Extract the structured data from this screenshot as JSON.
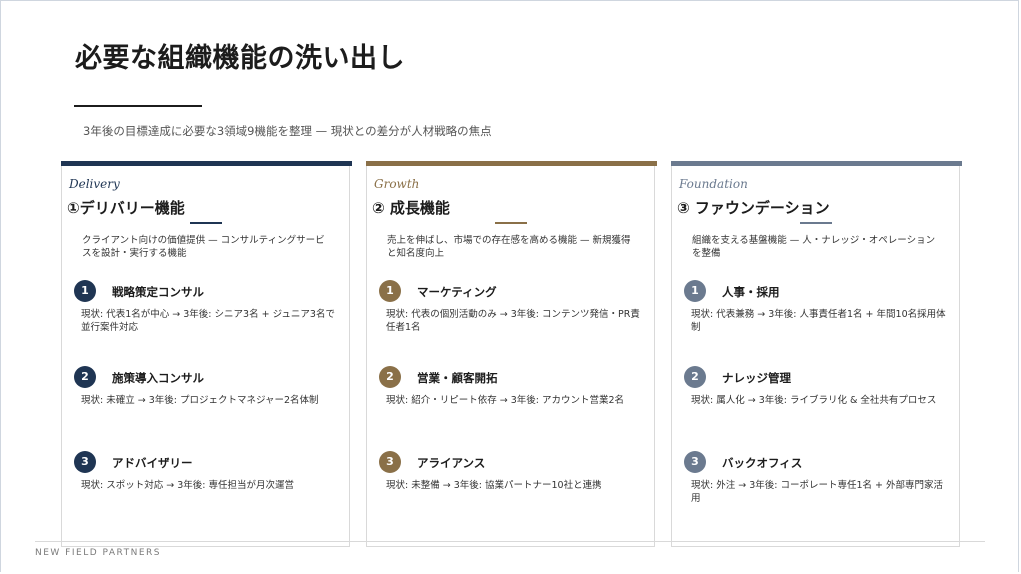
{
  "title": "必要な組織機能の洗い出し",
  "subtitle": "3年後の目標達成に必要な3領域9機能を整理 — 現状との差分が人材戦略の焦点",
  "footer": "NEW FIELD PARTNERS",
  "colors": {
    "delivery": "#1f3553",
    "growth": "#8a7048",
    "foundation": "#6b7a8f"
  },
  "cards": [
    {
      "category": "Delivery",
      "title": "①デリバリー機能",
      "description": "クライアント向けの価値提供 — コンサルティングサービスを設計・実行する機能",
      "items": [
        {
          "num": "1",
          "title": "戦略策定コンサル",
          "desc": "現状: 代表1名が中心 → 3年後: シニア3名 + ジュニア3名で並行案件対応"
        },
        {
          "num": "2",
          "title": "施策導入コンサル",
          "desc": "現状: 未確立 → 3年後: プロジェクトマネジャー2名体制"
        },
        {
          "num": "3",
          "title": "アドバイザリー",
          "desc": "現状: スポット対応 → 3年後: 専任担当が月次運営"
        }
      ]
    },
    {
      "category": "Growth",
      "title": "② 成長機能",
      "description": "売上を伸ばし、市場での存在感を高める機能 — 新規獲得と知名度向上",
      "items": [
        {
          "num": "1",
          "title": "マーケティング",
          "desc": "現状: 代表の個別活動のみ → 3年後: コンテンツ発信・PR責任者1名"
        },
        {
          "num": "2",
          "title": "営業・顧客開拓",
          "desc": "現状: 紹介・リピート依存 → 3年後: アカウント営業2名"
        },
        {
          "num": "3",
          "title": "アライアンス",
          "desc": "現状: 未整備 → 3年後: 協業パートナー10社と連携"
        }
      ]
    },
    {
      "category": "Foundation",
      "title": "③ ファウンデーション",
      "description": "組織を支える基盤機能 — 人・ナレッジ・オペレーションを整備",
      "items": [
        {
          "num": "1",
          "title": "人事・採用",
          "desc": "現状: 代表兼務 → 3年後: 人事責任者1名 + 年間10名採用体制"
        },
        {
          "num": "2",
          "title": "ナレッジ管理",
          "desc": "現状: 属人化 → 3年後: ライブラリ化 & 全社共有プロセス"
        },
        {
          "num": "3",
          "title": "バックオフィス",
          "desc": "現状: 外注 → 3年後: コーポレート専任1名 + 外部専門家活用"
        }
      ]
    }
  ]
}
